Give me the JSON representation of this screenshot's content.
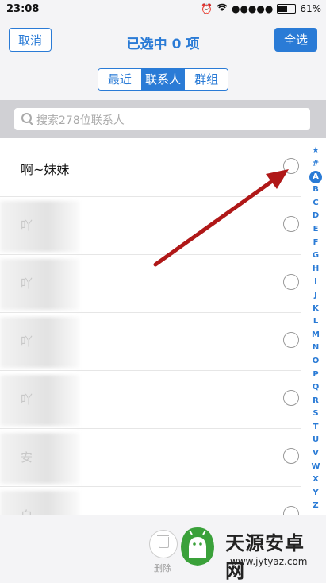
{
  "status": {
    "time": "23:08",
    "signal": "●●●●●",
    "battery": "61%",
    "battery_level": 0.61
  },
  "nav": {
    "cancel": "取消",
    "title": "已选中 0 项",
    "select_all": "全选"
  },
  "tabs": [
    {
      "label": "最近",
      "active": false
    },
    {
      "label": "联系人",
      "active": true
    },
    {
      "label": "群组",
      "active": false
    }
  ],
  "search": {
    "placeholder": "搜索278位联系人"
  },
  "contacts": [
    {
      "name": "啊~妹妹",
      "blurred": false
    },
    {
      "name": "吖",
      "blurred": true
    },
    {
      "name": "吖",
      "blurred": true
    },
    {
      "name": "吖",
      "blurred": true
    },
    {
      "name": "吖",
      "blurred": true
    },
    {
      "name": "安",
      "blurred": true
    },
    {
      "name": "白",
      "blurred": true
    }
  ],
  "index_letters": [
    "★",
    "#",
    "A",
    "B",
    "C",
    "D",
    "E",
    "F",
    "G",
    "H",
    "I",
    "J",
    "K",
    "L",
    "M",
    "N",
    "O",
    "P",
    "Q",
    "R",
    "S",
    "T",
    "U",
    "V",
    "W",
    "X",
    "Y",
    "Z"
  ],
  "index_active": "A",
  "bottom": {
    "delete_label": "删除"
  },
  "watermark": {
    "title": "天源安卓网",
    "url": "www.jytyaz.com"
  },
  "colors": {
    "accent": "#2a7bd6",
    "arrow": "#b01818",
    "watermark_green": "#3aa13a"
  }
}
